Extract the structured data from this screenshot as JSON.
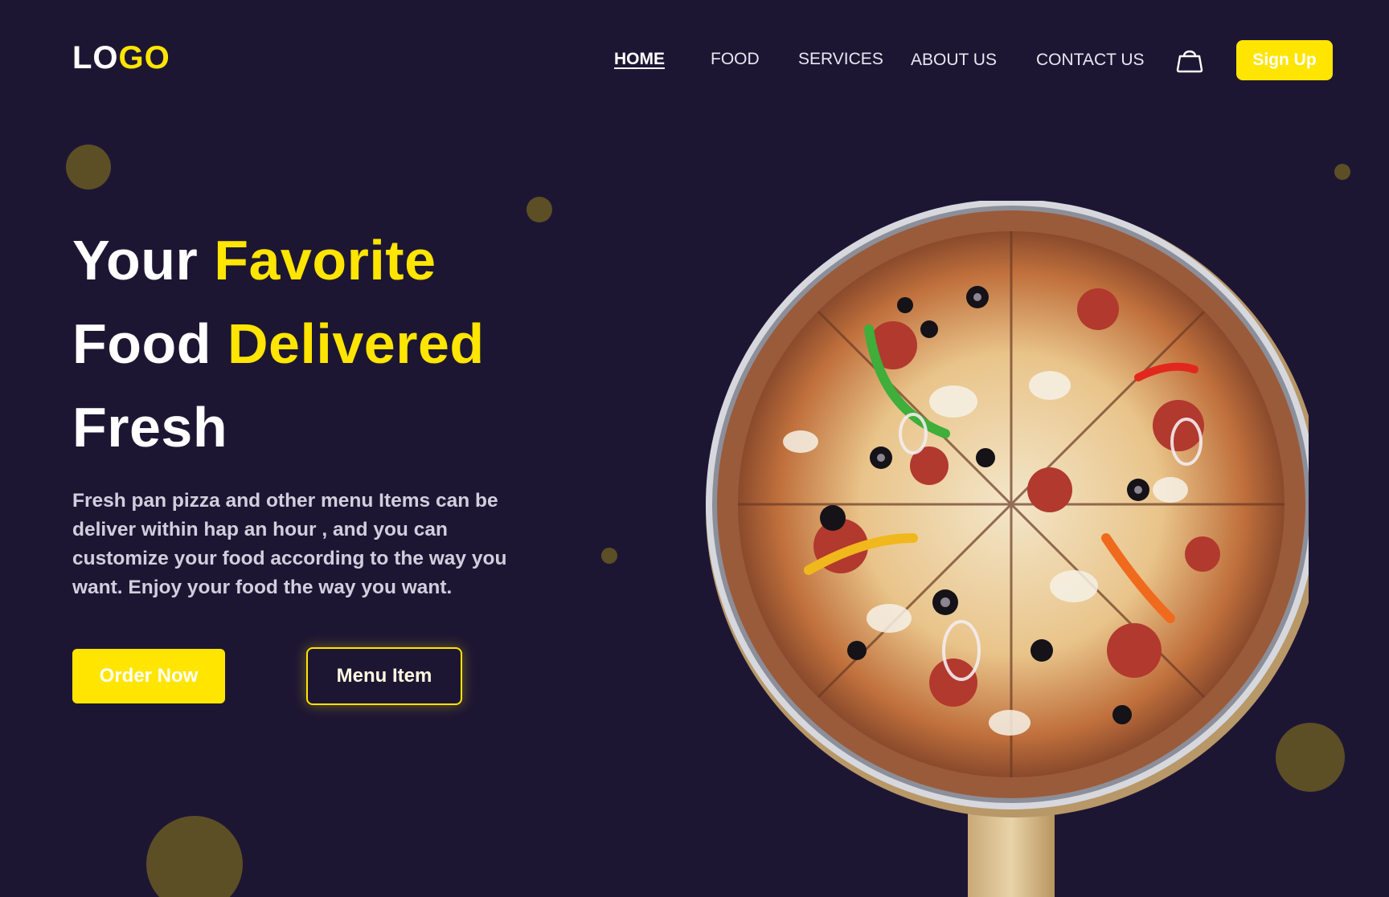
{
  "header": {
    "logo": {
      "part1": "LO",
      "part2": "GO"
    },
    "nav": [
      {
        "label": "HOME",
        "active": true
      },
      {
        "label": "FOOD",
        "active": false
      },
      {
        "label": "SERVICES",
        "active": false
      },
      {
        "label": "ABOUT US",
        "active": false
      },
      {
        "label": "CONTACT US",
        "active": false
      }
    ],
    "cart_icon": "shopping-bag-icon",
    "signup_label": "Sign Up"
  },
  "hero": {
    "headline": {
      "line1_white": "Your",
      "line1_yellow": "Favorite",
      "line2_white": "Food",
      "line2_yellow": "Delivered",
      "line3_white": "Fresh"
    },
    "description": "Fresh pan pizza and other menu Items can be deliver within hap an hour , and you can customize your food according to the way you want. Enjoy your food the way you want.",
    "order_button": "Order Now",
    "menu_button": "Menu Item",
    "image": "pizza-on-wooden-board"
  },
  "colors": {
    "background": "#1d1633",
    "accent": "#ffe500",
    "dot": "#5c4f25",
    "text": "#ffffff",
    "muted_text": "#d2cedd"
  }
}
